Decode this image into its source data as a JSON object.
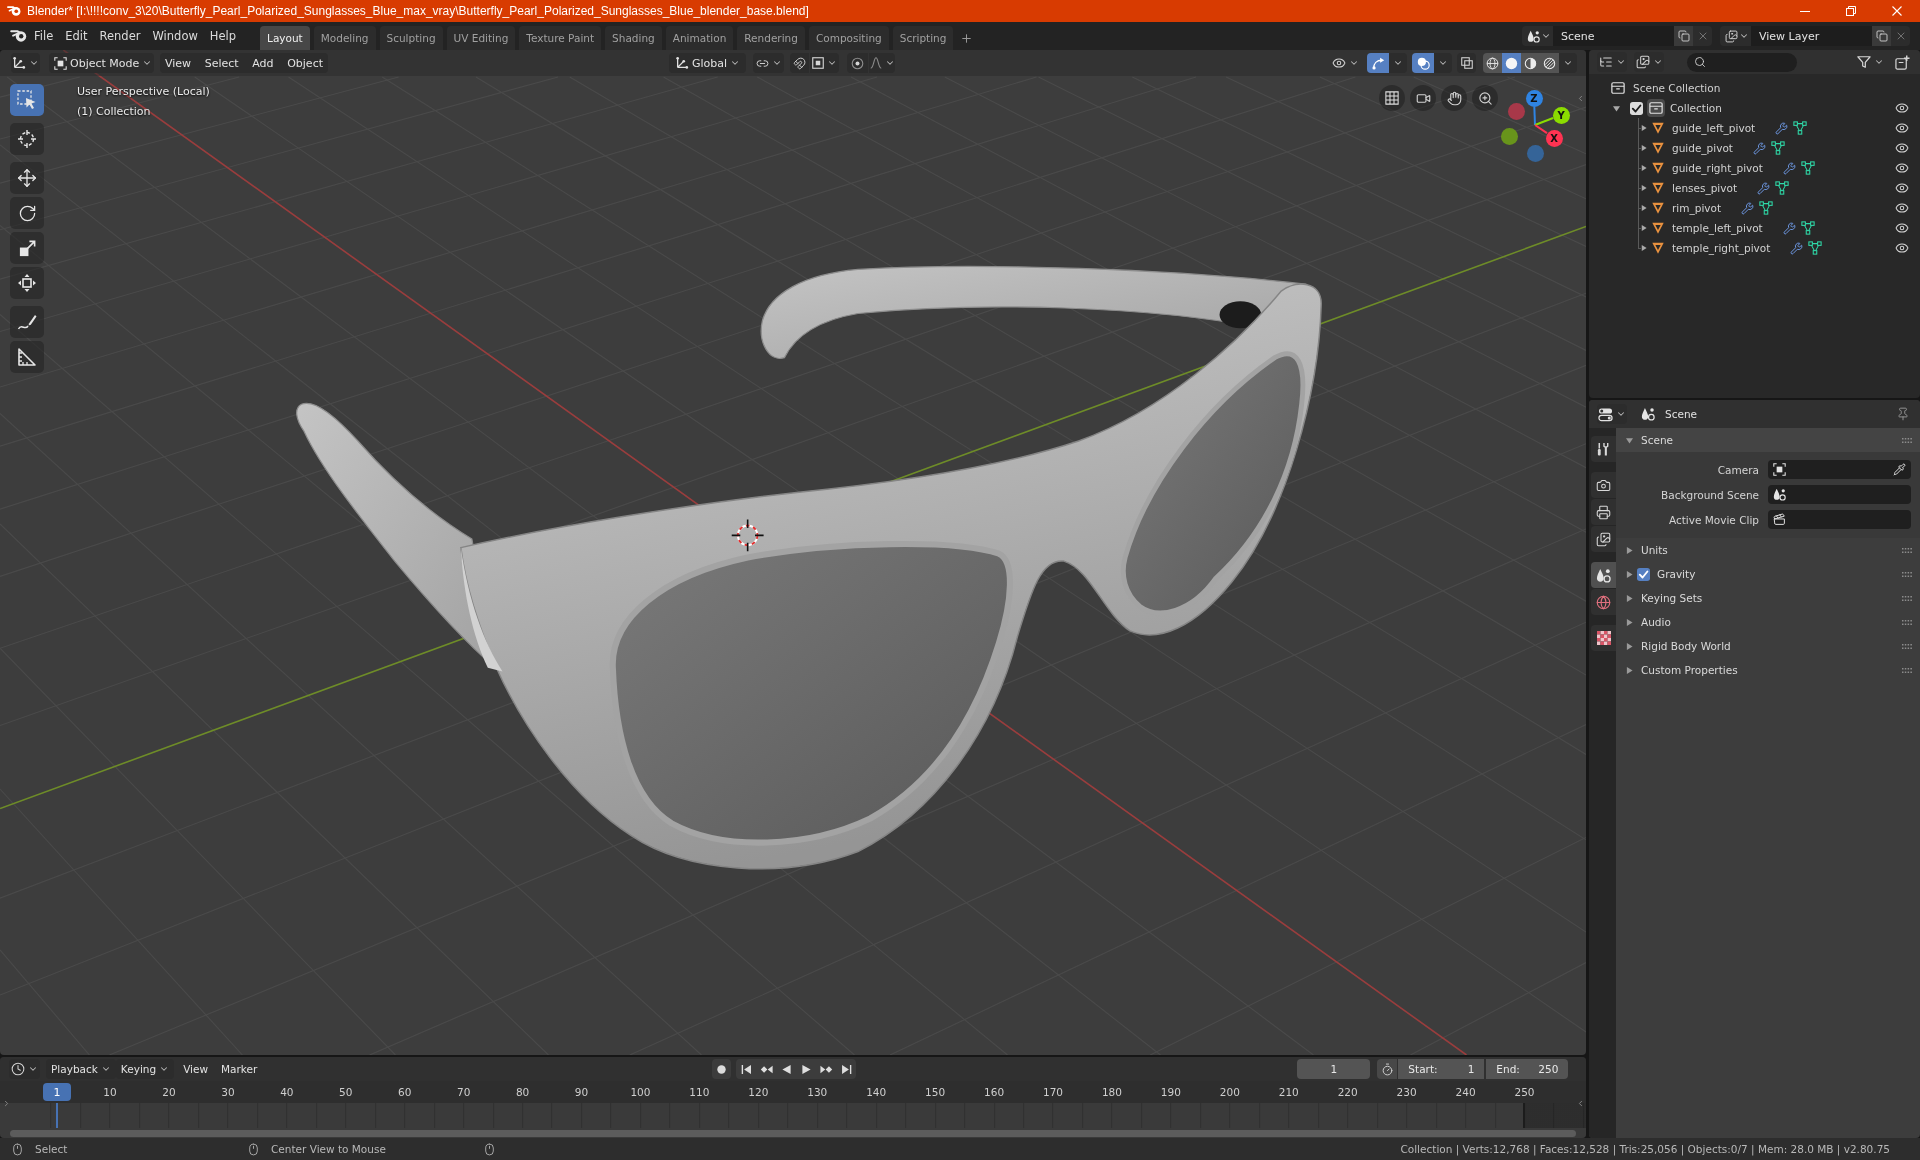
{
  "window": {
    "title": "Blender* [I:\\!!!!conv_3\\20\\Butterfly_Pearl_Polarized_Sunglasses_Blue_max_vray\\Butterfly_Pearl_Polarized_Sunglasses_Blue_blender_base.blend]"
  },
  "top_bar": {
    "menus": [
      "File",
      "Edit",
      "Render",
      "Window",
      "Help"
    ],
    "workspaces": [
      {
        "label": "Layout",
        "selected": true
      },
      {
        "label": "Modeling",
        "selected": false
      },
      {
        "label": "Sculpting",
        "selected": false
      },
      {
        "label": "UV Editing",
        "selected": false
      },
      {
        "label": "Texture Paint",
        "selected": false
      },
      {
        "label": "Shading",
        "selected": false
      },
      {
        "label": "Animation",
        "selected": false
      },
      {
        "label": "Rendering",
        "selected": false
      },
      {
        "label": "Compositing",
        "selected": false
      },
      {
        "label": "Scripting",
        "selected": false
      }
    ],
    "scene": "Scene",
    "view_layer": "View Layer"
  },
  "viewport": {
    "header": {
      "mode": "Object Mode",
      "menus": [
        "View",
        "Select",
        "Add",
        "Object"
      ],
      "orientation": "Global",
      "gizmos_on": true,
      "overlays_on": true,
      "shading": [
        {
          "kind": "wireframe",
          "selected": false
        },
        {
          "kind": "solid",
          "selected": true
        },
        {
          "kind": "material",
          "selected": false
        },
        {
          "kind": "rendered",
          "selected": false
        }
      ]
    },
    "info": [
      "User Perspective (Local)",
      "(1) Collection"
    ],
    "tool_groups": [
      {
        "tools": [
          {
            "kind": "select",
            "selected": true
          }
        ]
      },
      {
        "tools": [
          {
            "kind": "cursor",
            "selected": false
          }
        ]
      },
      {
        "tools": [
          {
            "kind": "move",
            "selected": false
          },
          {
            "kind": "rotate",
            "selected": false
          },
          {
            "kind": "scale",
            "selected": false
          },
          {
            "kind": "transform",
            "selected": false
          }
        ]
      },
      {
        "tools": [
          {
            "kind": "annotate",
            "selected": false
          },
          {
            "kind": "measure",
            "selected": false
          }
        ]
      }
    ],
    "gizmo": [
      {
        "label": "Z",
        "color": "#2f84e3"
      },
      {
        "label": "Y",
        "color": "#8bdc00"
      },
      {
        "label": "X",
        "color": "#ff3352"
      }
    ]
  },
  "outliner": {
    "tree": [
      {
        "label": "Scene Collection",
        "children": [
          {
            "label": "Collection",
            "expanded": true,
            "checkbox": {
              "checked": true
            },
            "children": [
              {
                "label": "guide_left_pivot",
                "expanded": false
              },
              {
                "label": "guide_pivot",
                "expanded": false
              },
              {
                "label": "guide_right_pivot",
                "expanded": false
              },
              {
                "label": "lenses_pivot",
                "expanded": false
              },
              {
                "label": "rim_pivot",
                "expanded": false
              },
              {
                "label": "temple_left_pivot",
                "expanded": false
              },
              {
                "label": "temple_right_pivot",
                "expanded": false
              }
            ]
          }
        ]
      }
    ]
  },
  "properties": {
    "context": "Scene",
    "tab_groups": [
      {
        "tabs": [
          {
            "kind": "tool",
            "selected": false
          }
        ]
      },
      {
        "tabs": [
          {
            "kind": "render",
            "selected": false
          },
          {
            "kind": "output",
            "selected": false
          },
          {
            "kind": "view_layer",
            "selected": false
          }
        ]
      },
      {
        "tabs": [
          {
            "kind": "scene",
            "selected": true
          },
          {
            "kind": "world",
            "selected": false
          }
        ]
      },
      {
        "tabs": [
          {
            "kind": "texture",
            "selected": false
          }
        ]
      }
    ],
    "panels": [
      {
        "title": "Scene",
        "expanded": true,
        "fields": [
          {
            "label": "Camera",
            "kind": "camera"
          },
          {
            "label": "Background Scene",
            "kind": "scene"
          },
          {
            "label": "Active Movie Clip",
            "kind": "clip"
          }
        ]
      },
      {
        "title": "Units",
        "expanded": false
      },
      {
        "title": "Gravity",
        "expanded": false,
        "checkbox": {
          "checked": true
        }
      },
      {
        "title": "Keying Sets",
        "expanded": false
      },
      {
        "title": "Audio",
        "expanded": false
      },
      {
        "title": "Rigid Body World",
        "expanded": false
      },
      {
        "title": "Custom Properties",
        "expanded": false
      }
    ]
  },
  "timeline": {
    "menus": [
      {
        "label": "Playback",
        "kind": "dropdown"
      },
      {
        "label": "Keying",
        "kind": "dropdown"
      },
      {
        "label": "View",
        "kind": "menu"
      },
      {
        "label": "Marker",
        "kind": "menu"
      }
    ],
    "auto_keying": false,
    "current_frame": "1",
    "start": {
      "label": "Start:",
      "value": "1"
    },
    "end": {
      "label": "End:",
      "value": "250"
    },
    "playhead": "1",
    "ruler": [
      "10",
      "20",
      "30",
      "40",
      "50",
      "60",
      "70",
      "80",
      "90",
      "100",
      "110",
      "120",
      "130",
      "140",
      "150",
      "160",
      "170",
      "180",
      "190",
      "200",
      "210",
      "220",
      "230",
      "240",
      "250"
    ]
  },
  "status_bar": {
    "hints": [
      "Select",
      "Center View to Mouse"
    ],
    "stats": "Collection | Verts:12,768 | Faces:12,528 | Tris:25,056 | Objects:0/7 | Mem: 28.0 MB | v2.80.75"
  }
}
